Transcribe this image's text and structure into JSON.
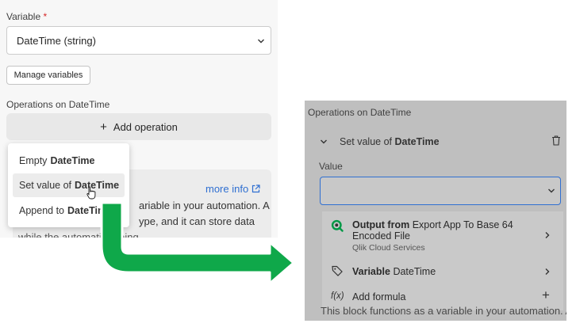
{
  "left": {
    "variable_label": "Variable",
    "required_mark": "*",
    "variable_value": "DateTime (string)",
    "manage_label": "Manage variables",
    "operations_label": "Operations on DateTime",
    "add_operation_label": "Add operation",
    "info_link": "more info",
    "desc_line1": "ariable in your automation. A",
    "desc_line2": "ype, and it can store data",
    "desc_line3": "while the automati      running",
    "menu": [
      {
        "prefix": "Empty",
        "bold": "DateTime"
      },
      {
        "prefix": "Set value of",
        "bold": "DateTime"
      },
      {
        "prefix": "Append to",
        "bold": "DateTime"
      }
    ]
  },
  "right": {
    "operations_label": "Operations on DateTime",
    "header_prefix": "Set value of",
    "header_bold": "DateTime",
    "value_label": "Value",
    "menu": {
      "output": {
        "bold": "Output from",
        "text": "Export App To Base 64",
        "line2": "Encoded File",
        "sub": "Qlik Cloud Services"
      },
      "variable": {
        "bold": "Variable",
        "text": "DateTime"
      },
      "formula": {
        "text": "Add formula"
      }
    },
    "bottom_text": "This block functions as a variable in your automation. A"
  },
  "colors": {
    "accent": "#2f6fd1",
    "arrow": "#0fa84a",
    "qlik": "#009845"
  }
}
